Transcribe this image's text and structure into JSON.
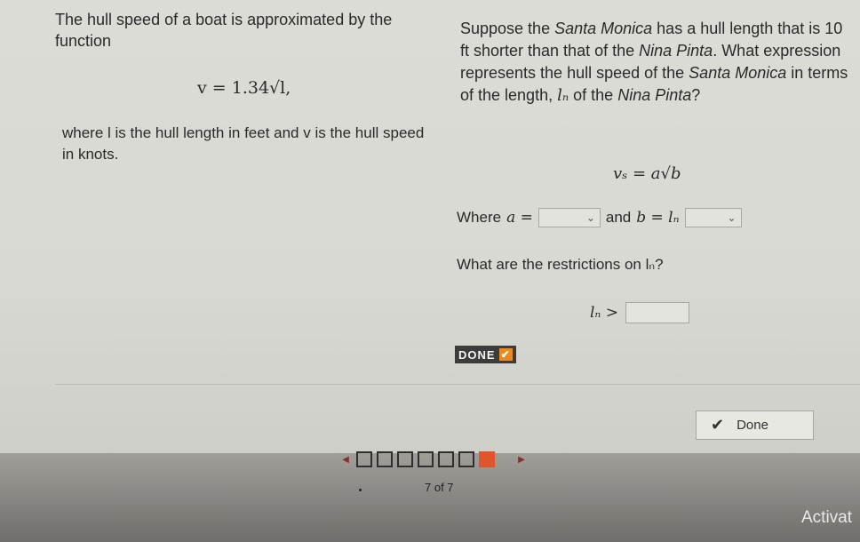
{
  "left": {
    "intro": "The hull speed of a boat is approximated by the function",
    "formula": "v = 1.34√l,",
    "explanation": "where l is the hull length in feet and v is the hull speed in knots."
  },
  "right": {
    "question_part1": "Suppose the ",
    "boat1": "Santa Monica",
    "question_part2": " has a hull length that is 10 ft shorter than that of the ",
    "boat2": "Nina Pinta",
    "question_part3": ". What expression represents the hull speed of the ",
    "boat3": "Santa Monica",
    "question_part4": " in terms of the length, ",
    "length_var": "lₙ",
    "question_part5": " of the ",
    "boat4": "Nina Pinta",
    "question_end": "?",
    "formula": "vₛ = a√b",
    "where_label": "Where",
    "a_eq": "a =",
    "and_label": "and",
    "b_eq": "b = lₙ",
    "restrictions_question": "What are the restrictions on lₙ?",
    "restriction_lhs": "lₙ >"
  },
  "done_badge": {
    "label": "DONE",
    "check": "✔"
  },
  "done_button": {
    "label": "Done",
    "icon": "checkmark-icon"
  },
  "pager": {
    "count": "7 of 7",
    "total": 7,
    "current": 7
  },
  "os_overlay": {
    "text": "Activat"
  }
}
